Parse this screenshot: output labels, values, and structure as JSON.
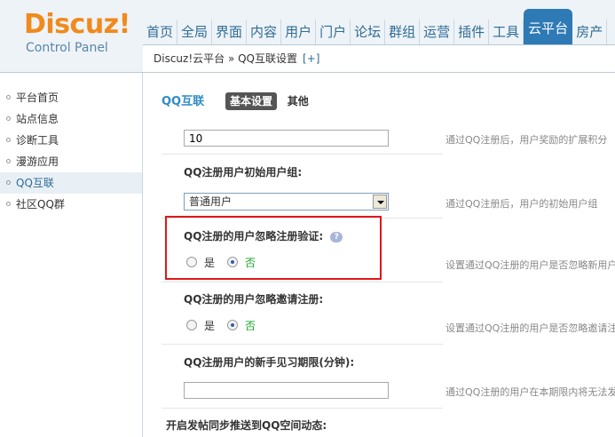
{
  "logo": {
    "brand": "Discuz",
    "bang": "!",
    "subtitle": "Control Panel"
  },
  "topnav": {
    "items": [
      "首页",
      "全局",
      "界面",
      "内容",
      "用户",
      "门户",
      "论坛",
      "群组",
      "运营",
      "插件",
      "工具",
      "云平台",
      "房产"
    ],
    "active_index": 11
  },
  "breadcrumb": {
    "path": "Discuz!云平台 » QQ互联设置",
    "add": "[+]"
  },
  "sidebar": {
    "items": [
      {
        "label": "平台首页"
      },
      {
        "label": "站点信息"
      },
      {
        "label": "诊断工具"
      },
      {
        "label": "漫游应用"
      },
      {
        "label": "QQ互联"
      },
      {
        "label": "社区QQ群"
      }
    ],
    "active_index": 4
  },
  "subtitle": {
    "title": "QQ互联",
    "tab_active": "基本设置",
    "tab_other": "其他"
  },
  "form": {
    "reward_value": "10",
    "reward_tip": "通过QQ注册后，用户奖励的扩展积分",
    "group_label": "QQ注册用户初始用户组:",
    "group_selected": "普通用户",
    "group_tip": "通过QQ注册后，用户的初始用户组",
    "ignore_verify_label": "QQ注册的用户忽略注册验证:",
    "help_glyph": "?",
    "ignore_verify_tip": "设置通过QQ注册的用户是否忽略新用户注册验证",
    "ignore_invite_label": "QQ注册的用户忽略邀请注册:",
    "ignore_invite_tip": "设置通过QQ注册的用户是否忽略邀请注册",
    "newbie_label": "QQ注册用户的新手见习期限(分钟):",
    "newbie_value": "",
    "newbie_tip": "通过QQ注册的用户在本期限内将无法发帖",
    "feed_section": "开启发帖同步推送到QQ空间动态:",
    "yes": "是",
    "no": "否"
  }
}
